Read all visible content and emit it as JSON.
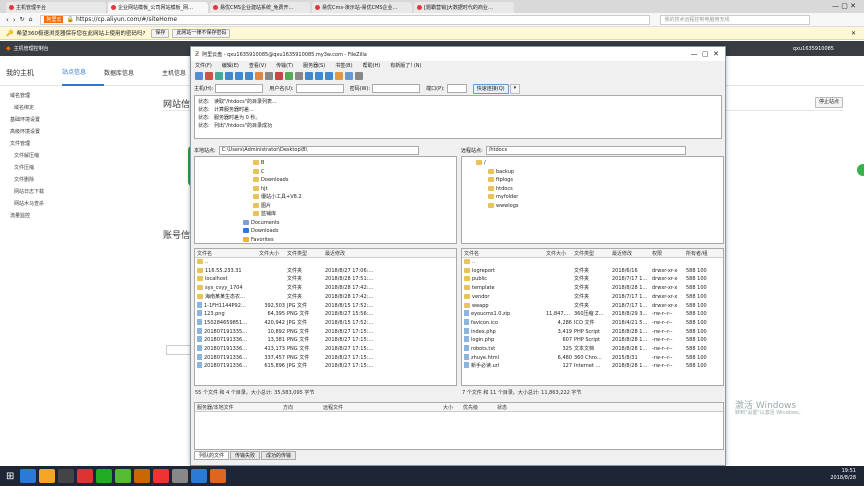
{
  "browser": {
    "tabs": [
      {
        "label": "主机管理平台",
        "color": "#e4393c"
      },
      {
        "label": "企业网站模板_公司网站模板_网…",
        "color": "#e4393c"
      },
      {
        "label": "易优CMS企业建站系统_免费开…",
        "color": "#e4393c"
      },
      {
        "label": "易优Cms-演示站-易优CMS企业…",
        "color": "#e4393c"
      },
      {
        "label": "[题霸营销]大数据时代的商业…",
        "color": "#e4393c"
      }
    ],
    "address_prefix": "阿里云",
    "url": "https://cp.aliyun.com/#/siteHome",
    "search_placeholder": "我的技术远程控制电脑用无线"
  },
  "password_bar": {
    "message": "希望360极速浏览器保存您在此网站上使用的密码吗?",
    "save": "保存",
    "never": "此网站一律不保存密码"
  },
  "aliyun": {
    "header_title": "主机管理控制台",
    "account": "qxu1635910085",
    "nav": [
      "我的主机",
      "站点信息",
      "数据库信息",
      "主机信息"
    ],
    "stop_button": "停止站点",
    "section_title": "网站信",
    "section2_title": "账号信",
    "side_groups": [
      {
        "label": "域名管理",
        "items": [
          "域名绑定"
        ]
      },
      {
        "label": "基础环境设置",
        "items": []
      },
      {
        "label": "高级环境设置",
        "items": []
      },
      {
        "label": "文件管理",
        "items": [
          "文件解压缩",
          "文件压缩",
          "文件删除",
          "网站日志下载",
          "网站木马查杀"
        ]
      },
      {
        "label": "流量监控",
        "items": []
      }
    ]
  },
  "filezilla": {
    "title": "阿里云盘 - qxu1635910085@qxu1635910085.my3w.com - FileZilla",
    "menu": [
      "文件(F)",
      "编辑(E)",
      "查看(V)",
      "传输(T)",
      "服务器(S)",
      "书签(B)",
      "帮助(H)",
      "有新版了! (N)"
    ],
    "quick": {
      "host": "主机(H):",
      "user": "用户名(U):",
      "pass": "密码(W):",
      "port": "端口(P):",
      "connect": "快速连接(Q)"
    },
    "log": [
      {
        "k": "状态:",
        "v": "读取\"/htdocs\"的目录列表..."
      },
      {
        "k": "状态:",
        "v": "计算服务器时差..."
      },
      {
        "k": "状态:",
        "v": "服务器时差为 0 秒。"
      },
      {
        "k": "状态:",
        "v": "列出\"/htdocs\"的目录成功"
      }
    ],
    "local_path_label": "本地站点:",
    "local_path": "C:\\Users\\Administrator\\Desktop\\B\\",
    "remote_path_label": "远程站点:",
    "remote_path": "/htdocs",
    "local_tree": [
      "B",
      "C",
      "Downloads",
      "hjt",
      "優站小工具+V8.2",
      "图片",
      "蓝铺库",
      "Documents",
      "Downloads",
      "Favorites"
    ],
    "remote_tree": [
      "/",
      "backup",
      "ftplogs",
      "htdocs",
      "myfolder",
      "wwwlogs"
    ],
    "local_headers": [
      "文件名",
      "文件大小",
      "文件类型",
      "最近修改"
    ],
    "local_files": [
      {
        "n": "..",
        "s": "",
        "t": "",
        "d": "",
        "f": true
      },
      {
        "n": "116.55.233.31",
        "s": "",
        "t": "文件夹",
        "d": "2018/8/27 17:06:…",
        "f": true
      },
      {
        "n": "localhost",
        "s": "",
        "t": "文件夹",
        "d": "2018/8/28 17:51:…",
        "f": true
      },
      {
        "n": "sys_cvyy_1704",
        "s": "",
        "t": "文件夹",
        "d": "2018/8/28 17:42:…",
        "f": true
      },
      {
        "n": "海南某某生态农…",
        "s": "",
        "t": "文件夹",
        "d": "2018/8/28 17:42:…",
        "f": true
      },
      {
        "n": "1-1FH1144P92…",
        "s": "392,503",
        "t": "JPG 文件",
        "d": "2018/8/15 17:52:…",
        "f": false
      },
      {
        "n": "123.png",
        "s": "64,395",
        "t": "PNG 文件",
        "d": "2018/8/27 15:56:…",
        "f": false
      },
      {
        "n": "150284659851…",
        "s": "420,942",
        "t": "JPG 文件",
        "d": "2018/8/15 17:52:…",
        "f": false
      },
      {
        "n": "201807191335…",
        "s": "10,892",
        "t": "PNG 文件",
        "d": "2018/8/27 17:15:…",
        "f": false
      },
      {
        "n": "201807191336…",
        "s": "13,381",
        "t": "PNG 文件",
        "d": "2018/8/27 17:15:…",
        "f": false
      },
      {
        "n": "201807191336…",
        "s": "413,173",
        "t": "PNG 文件",
        "d": "2018/8/27 17:15:…",
        "f": false
      },
      {
        "n": "201807191336…",
        "s": "337,457",
        "t": "PNG 文件",
        "d": "2018/8/27 17:15:…",
        "f": false
      },
      {
        "n": "201807191336…",
        "s": "615,896",
        "t": "JPG 文件",
        "d": "2018/8/27 17:15:…",
        "f": false
      }
    ],
    "local_status": "55 个文件 和 4 个目录。大小总计: 35,583,095 字节",
    "remote_headers": [
      "文件名",
      "文件大小",
      "文件类型",
      "最近修改",
      "权限",
      "所有者/组"
    ],
    "remote_files": [
      {
        "n": "..",
        "s": "",
        "t": "",
        "d": "",
        "p": "",
        "o": "",
        "f": true
      },
      {
        "n": "logreport",
        "s": "",
        "t": "文件夹",
        "d": "2018/6/16",
        "p": "drwxr-xr-x",
        "o": "588 100",
        "f": true
      },
      {
        "n": "public",
        "s": "",
        "t": "文件夹",
        "d": "2018/7/17 19…",
        "p": "drwxr-xr-x",
        "o": "588 100",
        "f": true
      },
      {
        "n": "template",
        "s": "",
        "t": "文件夹",
        "d": "2018/8/28 17…",
        "p": "drwxr-xr-x",
        "o": "588 100",
        "f": true
      },
      {
        "n": "vendor",
        "s": "",
        "t": "文件夹",
        "d": "2018/7/17 19…",
        "p": "drwxr-xr-x",
        "o": "588 100",
        "f": true
      },
      {
        "n": "weapp",
        "s": "",
        "t": "文件夹",
        "d": "2018/7/17 19…",
        "p": "drwxr-xr-x",
        "o": "588 100",
        "f": true
      },
      {
        "n": "eyoucms1.0.zip",
        "s": "11,847,978",
        "t": "360压缩 Z…",
        "d": "2018/8/29 3…",
        "p": "-rw-r--r--",
        "o": "588 100",
        "f": false
      },
      {
        "n": "favicon.ico",
        "s": "4,286",
        "t": "ICO 文件",
        "d": "2018/4/21 5…",
        "p": "-rw-r--r--",
        "o": "588 100",
        "f": false
      },
      {
        "n": "index.php",
        "s": "3,419",
        "t": "PHP Script",
        "d": "2018/8/28 1…",
        "p": "-rw-r--r--",
        "o": "588 100",
        "f": false
      },
      {
        "n": "login.php",
        "s": "607",
        "t": "PHP Script",
        "d": "2018/8/28 1…",
        "p": "-rw-r--r--",
        "o": "588 100",
        "f": false
      },
      {
        "n": "robots.txt",
        "s": "325",
        "t": "文本文档",
        "d": "2018/8/28 1…",
        "p": "-rw-r--r--",
        "o": "588 100",
        "f": false
      },
      {
        "n": "zhuye.html",
        "s": "6,480",
        "t": "360 Chro…",
        "d": "2015/8/31",
        "p": "-rw-r--r--",
        "o": "588 100",
        "f": false
      },
      {
        "n": "新手必读.url",
        "s": "127",
        "t": "Internet …",
        "d": "2018/8/28 1…",
        "p": "-rw-r--r--",
        "o": "588 100",
        "f": false
      }
    ],
    "remote_status": "7 个文件 和 11 个目录。大小总计: 11,863,222 字节",
    "queue_headers": [
      "服务器/本地文件",
      "方向",
      "远程文件",
      "大小",
      "优先级",
      "状态"
    ],
    "queue_tabs": [
      "列队的文件",
      "传输失败",
      "成功的传输"
    ]
  },
  "windows": {
    "watermark": "激活 Windows",
    "watermark_sub": "转到\"设置\"以激活 Windows。",
    "time": "19:51",
    "date": "2018/8/28"
  }
}
